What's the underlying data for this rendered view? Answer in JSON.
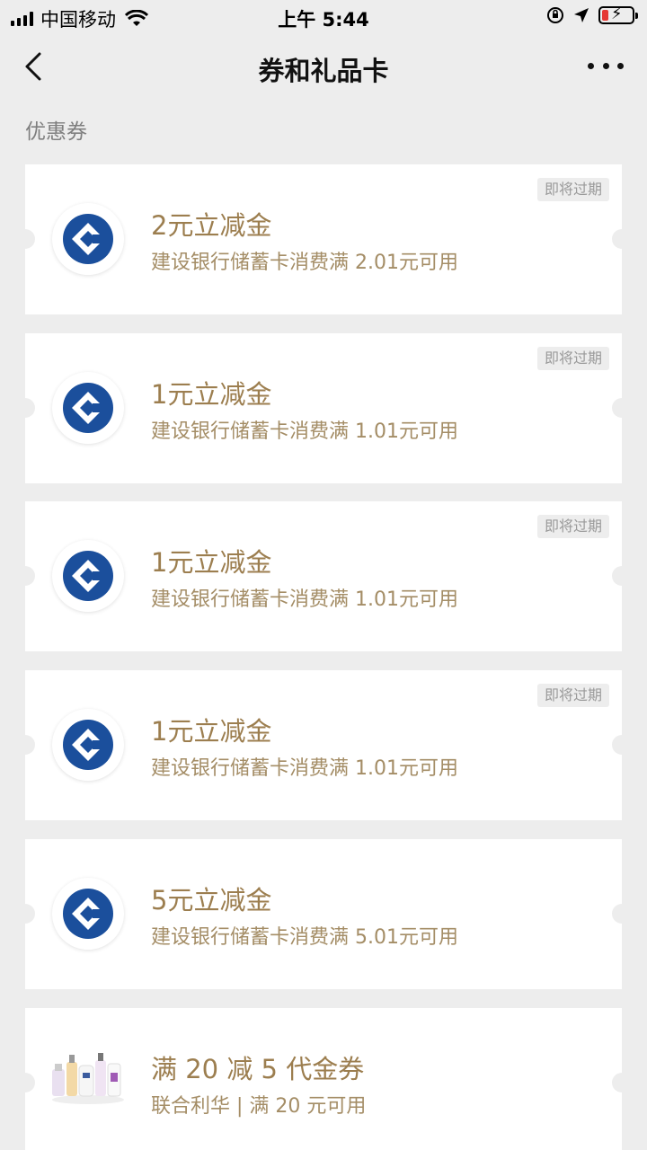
{
  "status_bar": {
    "carrier": "中国移动",
    "time": "上午 5:44"
  },
  "nav": {
    "title": "券和礼品卡",
    "back_icon": "chevron-left-icon",
    "more_icon": "more-dots-icon"
  },
  "section": {
    "title": "优惠券"
  },
  "colors": {
    "background": "#ededed",
    "gold": "#9c7e4f",
    "bank_blue": "#1b4f9c"
  },
  "coupons": [
    {
      "title": "2元立减金",
      "desc": "建设银行储蓄卡消费满 2.01元可用",
      "badge": "即将过期",
      "logo": "ccb-logo-icon"
    },
    {
      "title": "1元立减金",
      "desc": "建设银行储蓄卡消费满 1.01元可用",
      "badge": "即将过期",
      "logo": "ccb-logo-icon"
    },
    {
      "title": "1元立减金",
      "desc": "建设银行储蓄卡消费满 1.01元可用",
      "badge": "即将过期",
      "logo": "ccb-logo-icon"
    },
    {
      "title": "1元立减金",
      "desc": "建设银行储蓄卡消费满 1.01元可用",
      "badge": "即将过期",
      "logo": "ccb-logo-icon"
    },
    {
      "title": "5元立减金",
      "desc": "建设银行储蓄卡消费满 5.01元可用",
      "badge": "",
      "logo": "ccb-logo-icon"
    },
    {
      "title": "满 20 减 5 代金券",
      "desc": "联合利华 | 满 20 元可用",
      "badge": "",
      "logo": "product-bottles-icon"
    }
  ]
}
